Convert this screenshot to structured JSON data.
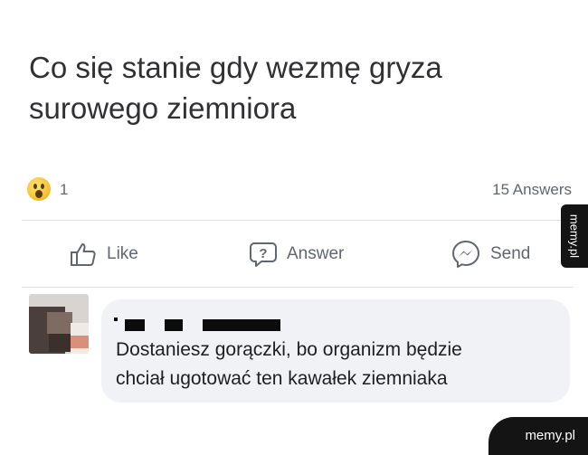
{
  "question": {
    "line1": "Co się stanie gdy wezmę gryza",
    "line2": "surowego ziemniora"
  },
  "stats": {
    "reaction_icon": "surprised-face-emoji",
    "reaction_count": "1",
    "answers_count": "15 Answers"
  },
  "actions": {
    "like": {
      "label": "Like",
      "icon": "thumbs-up-icon"
    },
    "answer": {
      "label": "Answer",
      "icon": "question-bubble-icon"
    },
    "send": {
      "label": "Send",
      "icon": "messenger-icon"
    }
  },
  "comment": {
    "line1": "Dostaniesz gorączki, bo organizm będzie",
    "line2": "chciał ugotować ten kawałek ziemniaka"
  },
  "watermarks": {
    "side": "memy.pl",
    "corner": "memy.pl"
  },
  "colors": {
    "text_primary": "#303134",
    "text_secondary": "#606770",
    "bubble_bg": "#f0f2f5",
    "divider": "#dddfe2",
    "watermark_bg": "#141414"
  }
}
